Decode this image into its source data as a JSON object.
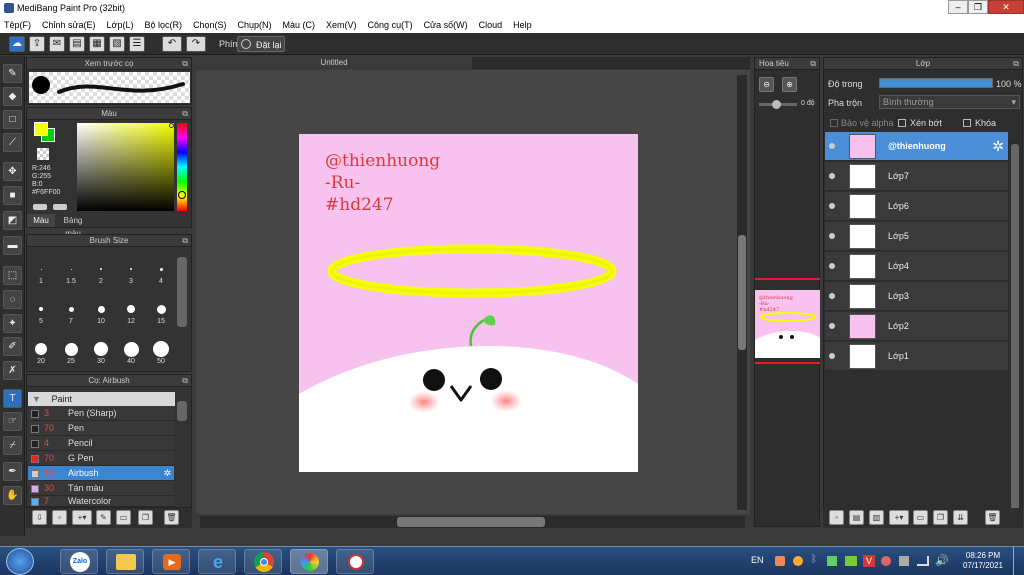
{
  "window": {
    "title": "MediBang Paint Pro (32bit)"
  },
  "menu": [
    "Tệp(F)",
    "Chỉnh sửa(E)",
    "Lớp(L)",
    "Bộ lọc(R)",
    "Chọn(S)",
    "Chụp(N)",
    "Màu (C)",
    "Xem(V)",
    "Công cụ(T)",
    "Cửa số(W)",
    "Cloud",
    "Help"
  ],
  "toolbar": {
    "shortcut_label": "Phím",
    "reset_label": "Đặt lại"
  },
  "brush_preview": {
    "title": "Xem trước cọ"
  },
  "color_panel": {
    "title": "Màu",
    "r": "R:246",
    "g": "G:255",
    "b": "B:0",
    "hex": "#F6FF00",
    "tab_color": "Màu",
    "tab_palette": "Bảng màu",
    "primary": "#F6FF00",
    "secondary": "#00CC00"
  },
  "brush_size": {
    "title": "Brush Size",
    "labels": [
      "1",
      "1.5",
      "2",
      "3",
      "4",
      "5",
      "7",
      "10",
      "12",
      "15",
      "20",
      "25",
      "30",
      "40",
      "50"
    ]
  },
  "brush_list": {
    "title": "Cọ: Airbush",
    "group": "Paint",
    "items": [
      {
        "num": "3",
        "name": "Pen (Sharp)"
      },
      {
        "num": "70",
        "name": "Pen"
      },
      {
        "num": "4",
        "name": "Pencil"
      },
      {
        "num": "70",
        "name": "G Pen"
      },
      {
        "num": "15",
        "name": "Airbush"
      },
      {
        "num": "30",
        "name": "Tán màu"
      },
      {
        "num": "7",
        "name": "Watercolor"
      }
    ]
  },
  "canvas": {
    "doc_title": "Untitled",
    "lines": [
      "@thienhuong",
      "-Ru-",
      "#hd247"
    ],
    "bg_color": "#F8C2EE"
  },
  "navigator": {
    "title": "Hoa tiêu",
    "rotation": "0 độ"
  },
  "layer_panel": {
    "title": "Lớp",
    "opacity_label": "Độ trong",
    "opacity_value": "100 %",
    "blend_label": "Pha trộn",
    "blend_value": "Bình thường",
    "protect_alpha": "Bảo vệ alpha",
    "clipping": "Xén bớt",
    "lock": "Khóa",
    "layers": [
      "@thienhuong",
      "Lớp7",
      "Lớp6",
      "Lớp5",
      "Lớp4",
      "Lớp3",
      "Lớp2",
      "Lớp1"
    ]
  },
  "taskbar": {
    "lang": "EN",
    "time": "08:26 PM",
    "date": "07/17/2021"
  }
}
